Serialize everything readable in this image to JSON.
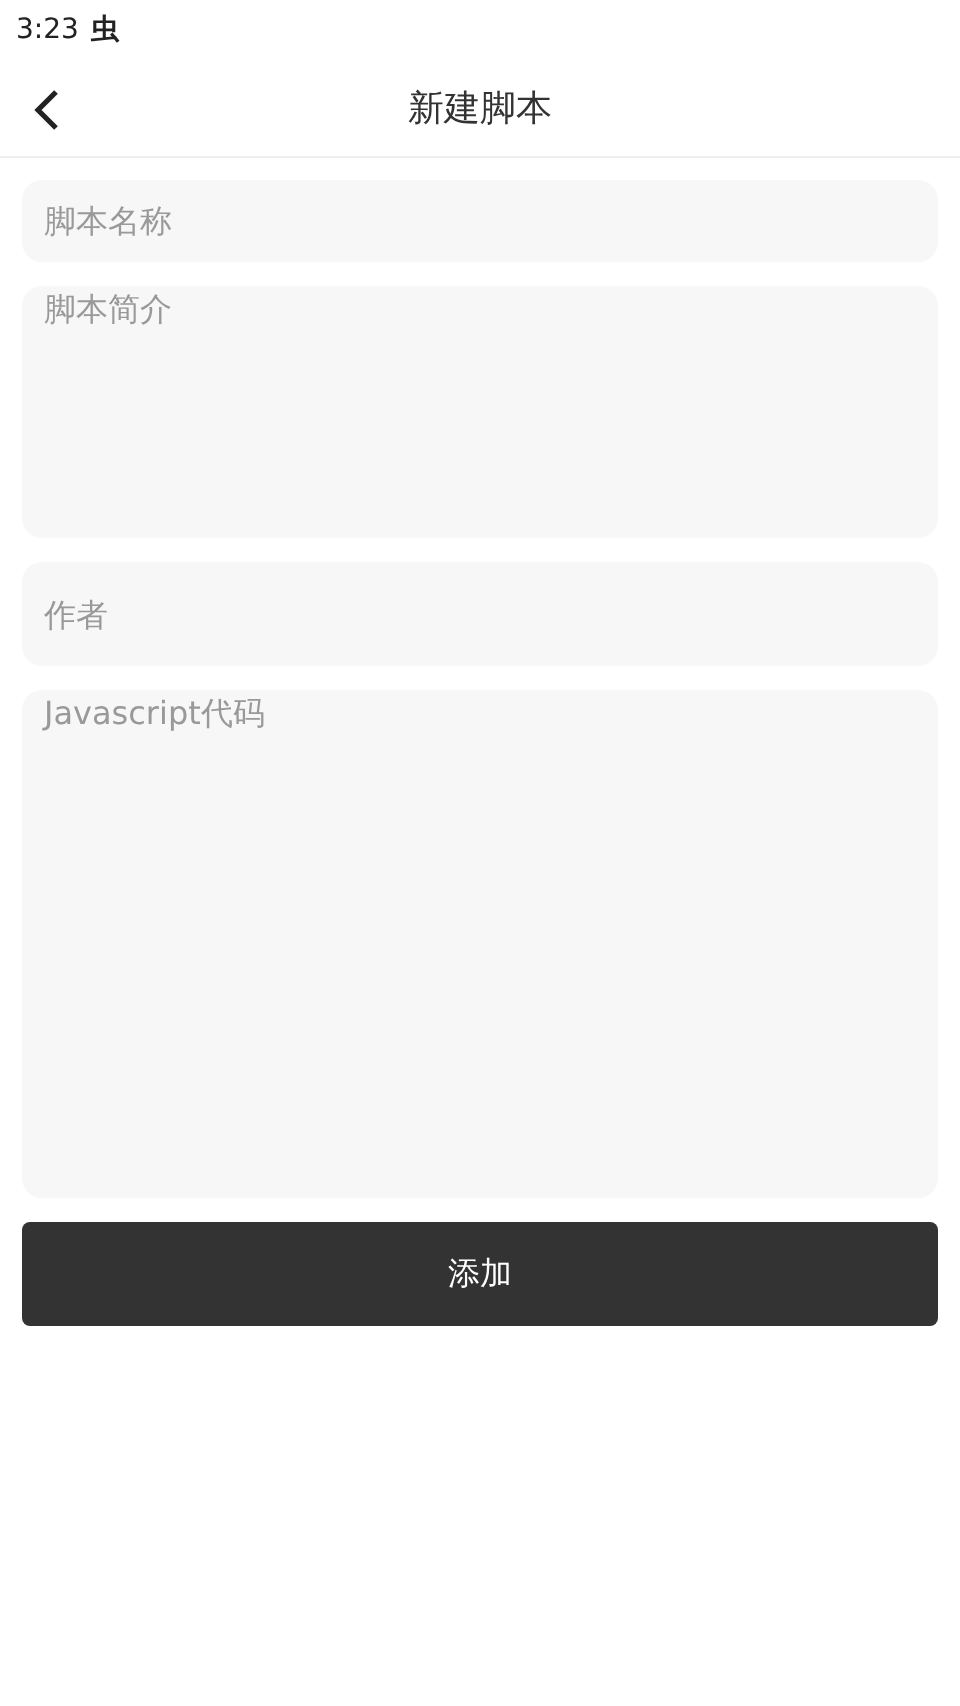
{
  "status_bar": {
    "time": "3:23",
    "notification": "虫"
  },
  "header": {
    "title": "新建脚本"
  },
  "fields": [
    {
      "kind": "line",
      "placeholder": "脚本名称"
    },
    {
      "kind": "area",
      "placeholder": "脚本简介"
    },
    {
      "kind": "tall-line",
      "placeholder": "作者"
    },
    {
      "kind": "code",
      "placeholder": "Javascript代码"
    }
  ],
  "submit_button": "添加"
}
